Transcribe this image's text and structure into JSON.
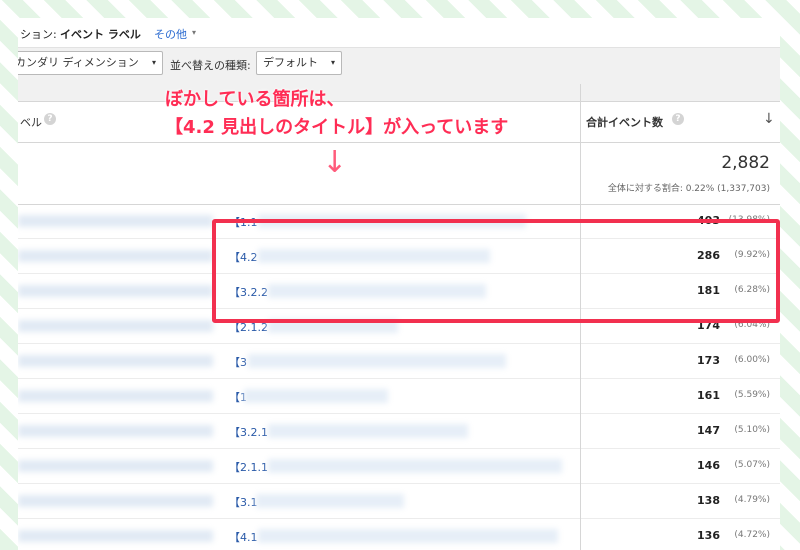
{
  "dimension_bar": {
    "prefix": "ション:",
    "active": "イベント ラベル",
    "other": "その他",
    "caret": "▾"
  },
  "controls": {
    "secondary_dimension": "カンダリ ディメンション",
    "sort_type_label": "並べ替えの種類:",
    "sort_type_value": "デフォルト",
    "caret": "▾"
  },
  "table_header": {
    "label_col": "ベル",
    "metric_col": "合計イベント数",
    "help": "?",
    "sort_arrow": "↓"
  },
  "totals": {
    "value": "2,882",
    "pct_text": "全体に対する割合: 0.22% (1,337,703)"
  },
  "rows": [
    {
      "label": "【1.1",
      "value": "403",
      "pct": "(13.98%)"
    },
    {
      "label": "【4.2",
      "value": "286",
      "pct": "(9.92%)"
    },
    {
      "label": "【3.2.2",
      "value": "181",
      "pct": "(6.28%)"
    },
    {
      "label": "【2.1.2",
      "value": "174",
      "pct": "(6.04%)"
    },
    {
      "label": "【3",
      "value": "173",
      "pct": "(6.00%)"
    },
    {
      "label": "【1",
      "value": "161",
      "pct": "(5.59%)"
    },
    {
      "label": "【3.2.1",
      "value": "147",
      "pct": "(5.10%)"
    },
    {
      "label": "【2.1.1",
      "value": "146",
      "pct": "(5.07%)"
    },
    {
      "label": "【3.1",
      "value": "138",
      "pct": "(4.79%)"
    },
    {
      "label": "【4.1",
      "value": "136",
      "pct": "(4.72%)"
    }
  ],
  "annotation": {
    "line1": "ぼかしている箇所は、",
    "line2": "【4.2 見出しのタイトル】が入っています",
    "arrow": "↓",
    "color": "#ff2d55"
  },
  "highlight_color": "#f2304f"
}
